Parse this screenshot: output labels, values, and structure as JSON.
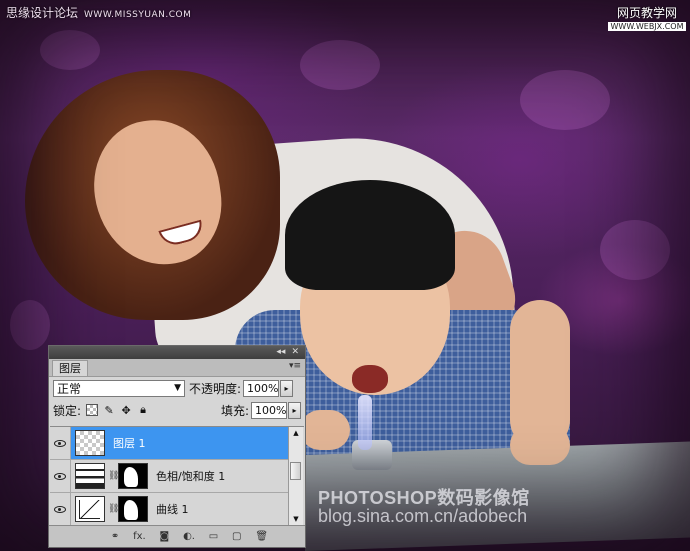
{
  "watermarks": {
    "top_left_title": "思缘设计论坛",
    "top_left_url": "WWW.MISSYUAN.COM",
    "top_right_title": "网页教学网",
    "top_right_url": "WWW.WEBJX.COM",
    "photo_brand": "PHOTOSHOP数码影像馆",
    "photo_blog": "blog.sina.com.cn/adobech"
  },
  "layers_panel": {
    "tab_label": "图层",
    "collapse_glyph": "◂◂",
    "close_glyph": "✕",
    "menu_glyph": "▾≡",
    "blend_mode": "正常",
    "opacity_label": "不透明度:",
    "opacity_value": "100%",
    "lock_label": "锁定:",
    "fill_label": "填充:",
    "fill_value": "100%",
    "layers": [
      {
        "name": "图层 1",
        "selected": true,
        "thumb": "transparent",
        "has_mask": false
      },
      {
        "name": "色相/饱和度 1",
        "selected": false,
        "thumb": "hue-saturation",
        "has_mask": true
      },
      {
        "name": "曲线 1",
        "selected": false,
        "thumb": "curves",
        "has_mask": true
      }
    ],
    "bottom_icons": [
      "link-icon",
      "fx-icon",
      "add-mask-icon",
      "adjustment-icon",
      "new-group-icon",
      "new-layer-icon",
      "trash-icon"
    ],
    "bottom_labels": [
      "⚭",
      "fx.",
      "◙",
      "◐.",
      "▭",
      "▢",
      "🗑"
    ]
  }
}
